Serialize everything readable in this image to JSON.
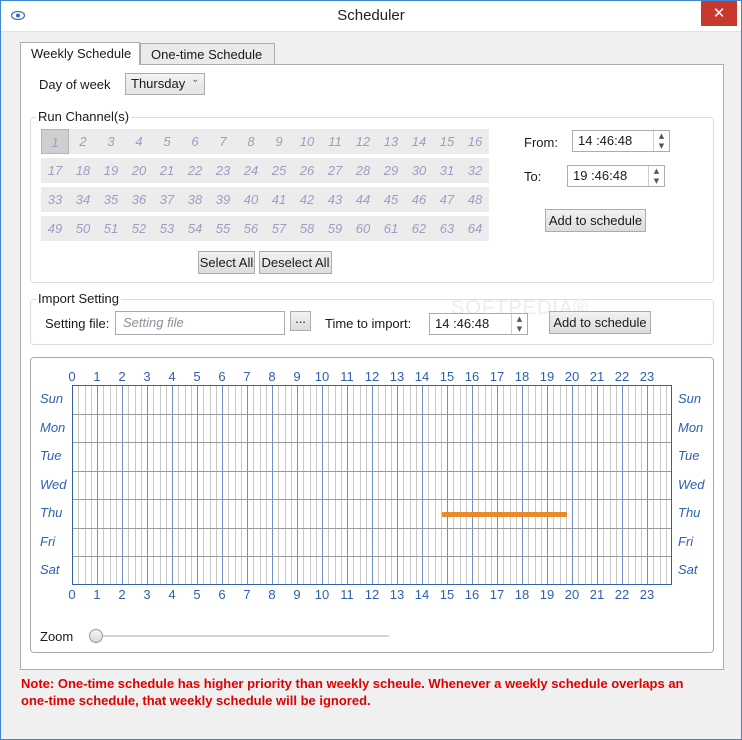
{
  "window": {
    "title": "Scheduler",
    "close_glyph": "✕",
    "app_icon": "eye-icon"
  },
  "tabs": [
    {
      "label": "Weekly Schedule",
      "active": true
    },
    {
      "label": "One-time Schedule",
      "active": false
    }
  ],
  "day_of_week": {
    "label": "Day of week",
    "value": "Thursday"
  },
  "run_channels": {
    "title": "Run Channel(s)",
    "channels": [
      "1",
      "2",
      "3",
      "4",
      "5",
      "6",
      "7",
      "8",
      "9",
      "10",
      "11",
      "12",
      "13",
      "14",
      "15",
      "16",
      "17",
      "18",
      "19",
      "20",
      "21",
      "22",
      "23",
      "24",
      "25",
      "26",
      "27",
      "28",
      "29",
      "30",
      "31",
      "32",
      "33",
      "34",
      "35",
      "36",
      "37",
      "38",
      "39",
      "40",
      "41",
      "42",
      "43",
      "44",
      "45",
      "46",
      "47",
      "48",
      "49",
      "50",
      "51",
      "52",
      "53",
      "54",
      "55",
      "56",
      "57",
      "58",
      "59",
      "60",
      "61",
      "62",
      "63",
      "64"
    ],
    "select_all": "Select All",
    "deselect_all": "Deselect All"
  },
  "time_range": {
    "from_label": "From:",
    "from_value": "14 :46:48",
    "to_label": "To:",
    "to_value": "19 :46:48",
    "add_button": "Add to schedule"
  },
  "import_setting": {
    "title": "Import Setting",
    "file_label": "Setting file:",
    "file_placeholder": "Setting file",
    "browse_button": "...",
    "time_label": "Time to import:",
    "time_value": "14 :46:48",
    "add_button": "Add to schedule"
  },
  "watermark": "SOFTPEDIA®",
  "schedule_grid": {
    "hours": [
      "0",
      "1",
      "2",
      "3",
      "4",
      "5",
      "6",
      "7",
      "8",
      "9",
      "10",
      "11",
      "12",
      "13",
      "14",
      "15",
      "16",
      "17",
      "18",
      "19",
      "20",
      "21",
      "22",
      "23"
    ],
    "days": [
      "Sun",
      "Mon",
      "Tue",
      "Wed",
      "Thu",
      "Fri",
      "Sat"
    ],
    "entries": [
      {
        "day": "Thu",
        "start_hour": 14.78,
        "end_hour": 19.78,
        "color": "#e9892a"
      }
    ]
  },
  "zoom": {
    "label": "Zoom",
    "value": 0
  },
  "note": "Note: One-time schedule has higher priority than weekly scheule. Whenever a weekly schedule overlaps an one-time schedule, that weekly schedule will be ignored."
}
